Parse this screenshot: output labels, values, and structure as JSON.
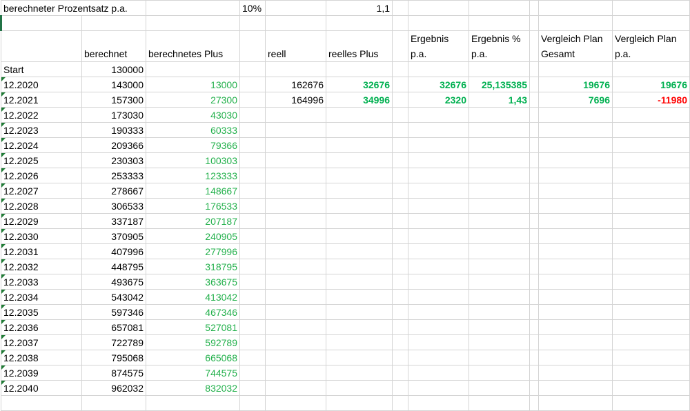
{
  "top": {
    "label": "berechneter Prozentsatz p.a.",
    "percent": "10%",
    "factor": "1,1"
  },
  "headers": {
    "berechnet": "berechnet",
    "berechnetes_plus": "berechnetes Plus",
    "reell": "reell",
    "reelles_plus": "reelles Plus",
    "ergebnis": "Ergebnis p.a.",
    "ergebnis_pct": "Ergebnis % p.a.",
    "vergleich_gesamt": "Vergleich Plan Gesamt",
    "vergleich_pa": "Vergleich Plan p.a."
  },
  "start": {
    "label": "Start",
    "value": "130000"
  },
  "rows": [
    {
      "date": "12.2020",
      "berechnet": "143000",
      "plus": "13000",
      "reell": "162676",
      "reelles_plus": "32676",
      "ergebnis": "32676",
      "ergebnis_pct": "25,135385",
      "vergleich_gesamt": "19676",
      "vergleich_pa": "19676"
    },
    {
      "date": "12.2021",
      "berechnet": "157300",
      "plus": "27300",
      "reell": "164996",
      "reelles_plus": "34996",
      "ergebnis": "2320",
      "ergebnis_pct": "1,43",
      "vergleich_gesamt": "7696",
      "vergleich_pa": "-11980"
    },
    {
      "date": "12.2022",
      "berechnet": "173030",
      "plus": "43030"
    },
    {
      "date": "12.2023",
      "berechnet": "190333",
      "plus": "60333"
    },
    {
      "date": "12.2024",
      "berechnet": "209366",
      "plus": "79366"
    },
    {
      "date": "12.2025",
      "berechnet": "230303",
      "plus": "100303"
    },
    {
      "date": "12.2026",
      "berechnet": "253333",
      "plus": "123333"
    },
    {
      "date": "12.2027",
      "berechnet": "278667",
      "plus": "148667"
    },
    {
      "date": "12.2028",
      "berechnet": "306533",
      "plus": "176533"
    },
    {
      "date": "12.2029",
      "berechnet": "337187",
      "plus": "207187"
    },
    {
      "date": "12.2030",
      "berechnet": "370905",
      "plus": "240905"
    },
    {
      "date": "12.2031",
      "berechnet": "407996",
      "plus": "277996"
    },
    {
      "date": "12.2032",
      "berechnet": "448795",
      "plus": "318795"
    },
    {
      "date": "12.2033",
      "berechnet": "493675",
      "plus": "363675"
    },
    {
      "date": "12.2034",
      "berechnet": "543042",
      "plus": "413042"
    },
    {
      "date": "12.2035",
      "berechnet": "597346",
      "plus": "467346"
    },
    {
      "date": "12.2036",
      "berechnet": "657081",
      "plus": "527081"
    },
    {
      "date": "12.2037",
      "berechnet": "722789",
      "plus": "592789"
    },
    {
      "date": "12.2038",
      "berechnet": "795068",
      "plus": "665068"
    },
    {
      "date": "12.2039",
      "berechnet": "874575",
      "plus": "744575"
    },
    {
      "date": "12.2040",
      "berechnet": "962032",
      "plus": "832032"
    }
  ],
  "colors": {
    "green": "#22b04b",
    "bold_green": "#00b050",
    "red": "#ff0000",
    "grid": "#d4d4d4"
  }
}
